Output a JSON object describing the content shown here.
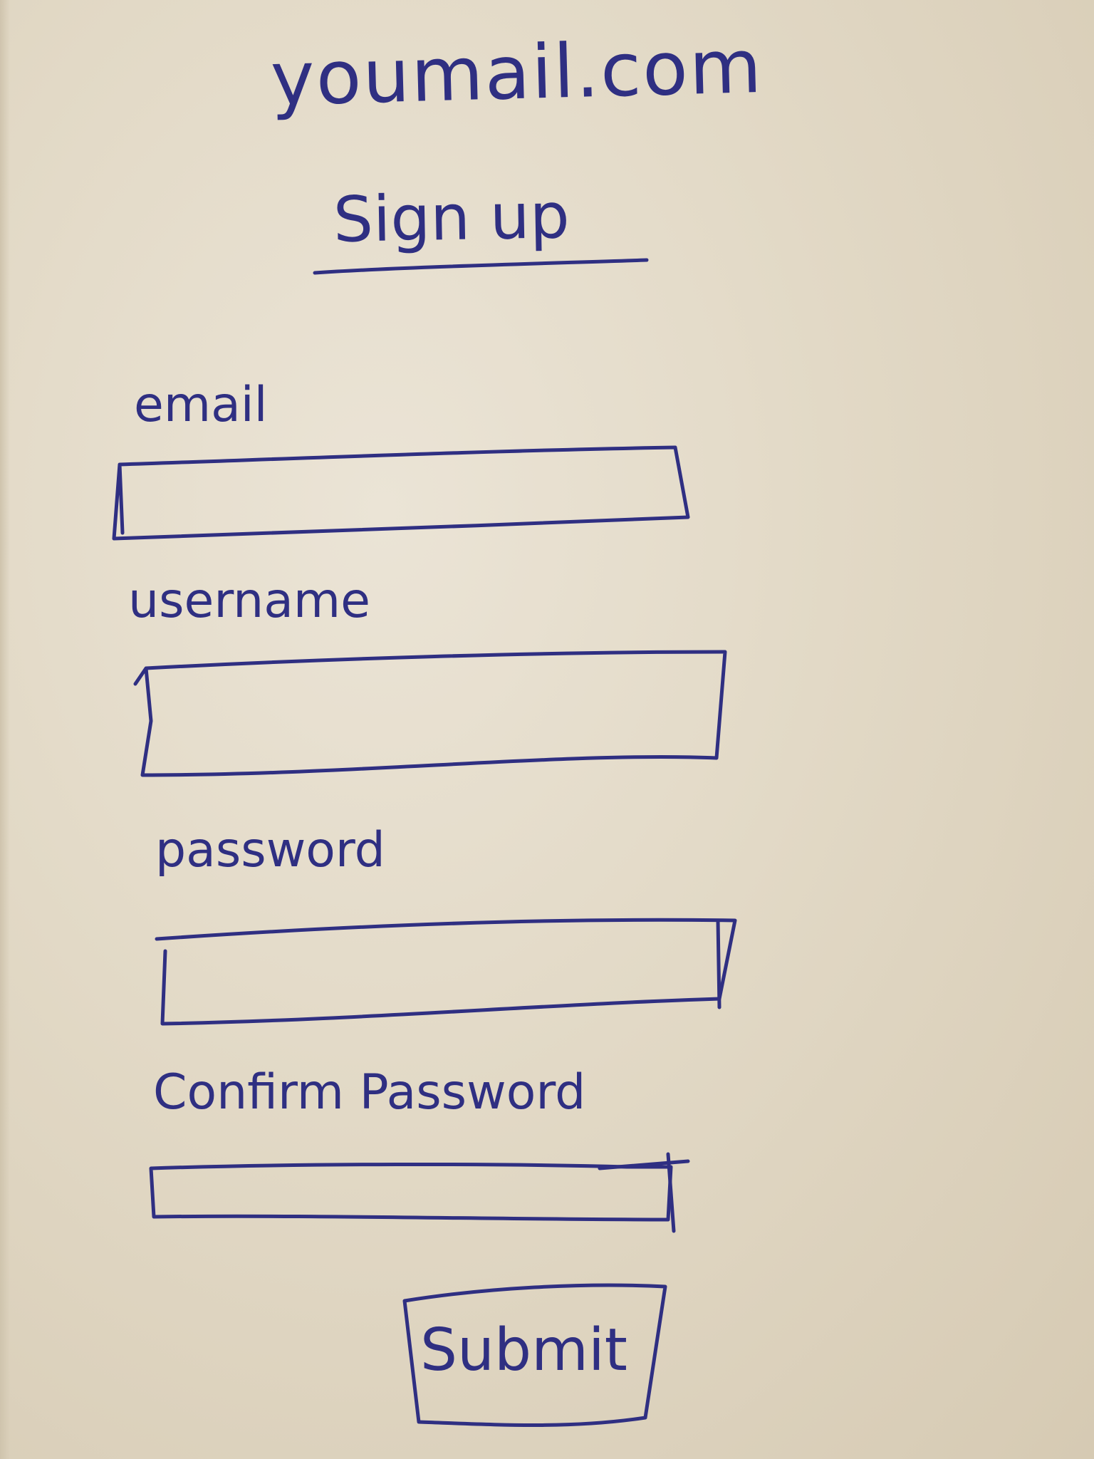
{
  "header": {
    "site_name": "youmail.com",
    "page_title": "Sign up"
  },
  "form": {
    "fields": [
      {
        "label": "email",
        "value": ""
      },
      {
        "label": "username",
        "value": ""
      },
      {
        "label": "password",
        "value": ""
      },
      {
        "label": "Confirm Password",
        "value": ""
      }
    ],
    "submit_label": "Submit"
  },
  "colors": {
    "ink": "#2f2f82",
    "paper": "#e2d9c6"
  }
}
